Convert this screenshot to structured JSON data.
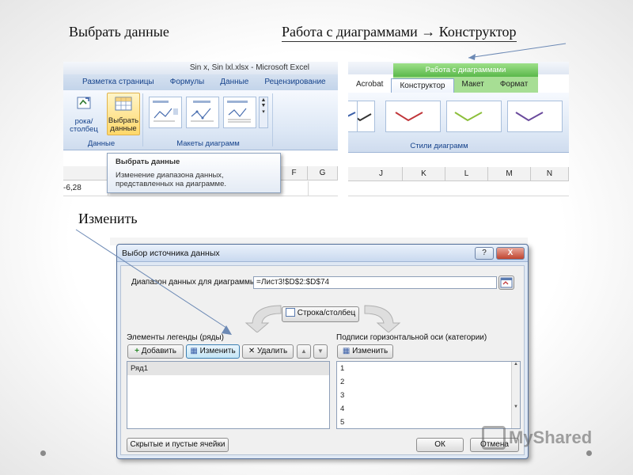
{
  "headings": {
    "select_data": "Выбрать данные",
    "path": "Работа с диаграммами → Конструктор",
    "change": "Изменить"
  },
  "ribbon_left": {
    "window_title": "Sin x, Sin lxl.xlsx - Microsoft Excel",
    "tabs": [
      "Разметка страницы",
      "Формулы",
      "Данные",
      "Рецензирование"
    ],
    "switch_row_col": "рока/столбец",
    "select_data_btn": "Выбрать данные",
    "group_data": "Данные",
    "group_layouts": "Макеты диаграмм",
    "cell_value": "-6,28",
    "col_headers": [
      "F",
      "G"
    ],
    "tooltip": {
      "title": "Выбрать данные",
      "text": "Изменение диапазона данных, представленных на диаграмме."
    }
  },
  "ribbon_right": {
    "context_title": "Работа с диаграммами",
    "tabs": [
      "Acrobat",
      "Конструктор",
      "Макет",
      "Формат"
    ],
    "group_styles": "Стили диаграмм",
    "col_headers": [
      "J",
      "K",
      "L",
      "M",
      "N"
    ],
    "style_colors": [
      "#333333",
      "#3a5fa8",
      "#c0363a",
      "#8cbf3b",
      "#6a4a9c"
    ]
  },
  "dialog": {
    "title": "Выбор источника данных",
    "help": "?",
    "close": "X",
    "range_label": "Диапазон данных для диаграммы:",
    "range_value": "=Лист3!$D$2:$D$74",
    "switch_btn": "Строка/столбец",
    "legend_label": "Элементы легенды (ряды)",
    "add_btn": "Добавить",
    "edit_btn": "Изменить",
    "delete_btn": "Удалить",
    "series": [
      "Ряд1"
    ],
    "axis_label": "Подписи горизонтальной оси (категории)",
    "axis_edit_btn": "Изменить",
    "categories": [
      "1",
      "2",
      "3",
      "4",
      "5"
    ],
    "hidden_cells_btn": "Скрытые и пустые ячейки",
    "ok": "ОК",
    "cancel": "Отмена"
  },
  "watermark": "MyShared"
}
